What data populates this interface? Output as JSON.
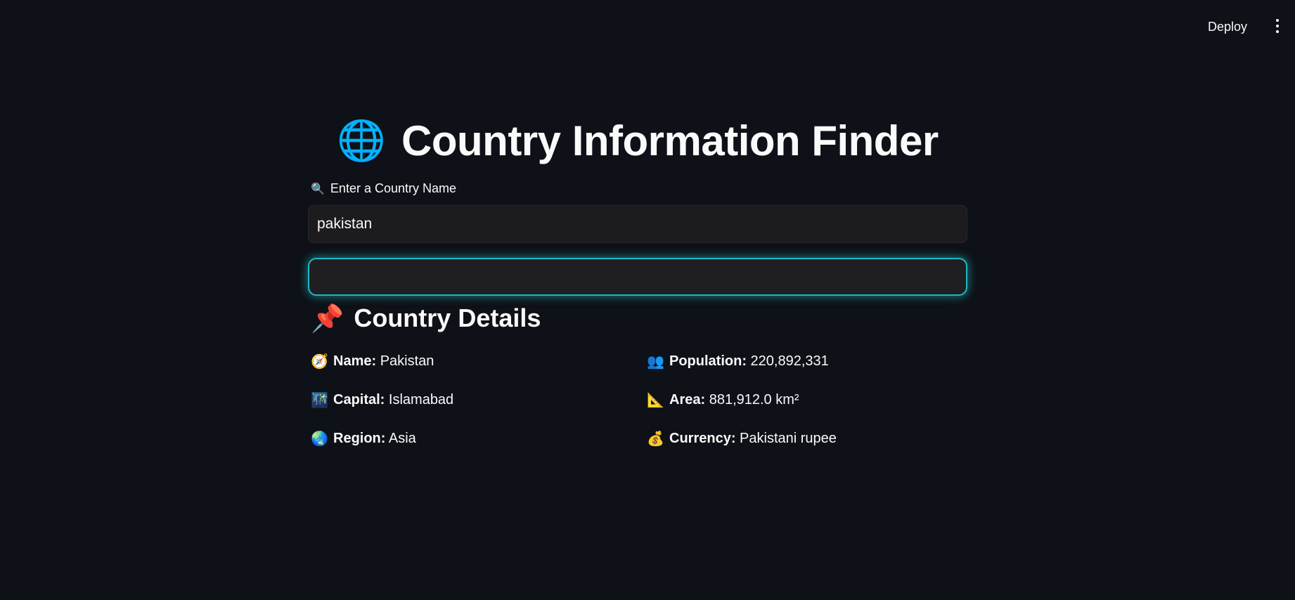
{
  "header": {
    "deploy_label": "Deploy",
    "menu_icon": "vertical-ellipsis-icon"
  },
  "title": {
    "icon": "🌐",
    "text": "Country Information Finder"
  },
  "search": {
    "label_icon": "🔍",
    "label": "Enter a Country Name",
    "value": "pakistan"
  },
  "details": {
    "heading_icon": "📌",
    "heading": "Country Details",
    "left": [
      {
        "icon": "🧭",
        "label": "Name:",
        "value": "Pakistan"
      },
      {
        "icon": "🌃",
        "label": "Capital:",
        "value": "Islamabad"
      },
      {
        "icon": "🌏",
        "label": "Region:",
        "value": "Asia"
      }
    ],
    "right": [
      {
        "icon": "👥",
        "label": "Population:",
        "value": "220,892,331"
      },
      {
        "icon": "📐",
        "label": "Area:",
        "value": "881,912.0 km²"
      },
      {
        "icon": "💰",
        "label": "Currency:",
        "value": "Pakistani rupee"
      }
    ]
  },
  "colors": {
    "background": "#0e1117",
    "accent_glow": "#1fb8c4",
    "input_bg": "#1c1c1f"
  }
}
